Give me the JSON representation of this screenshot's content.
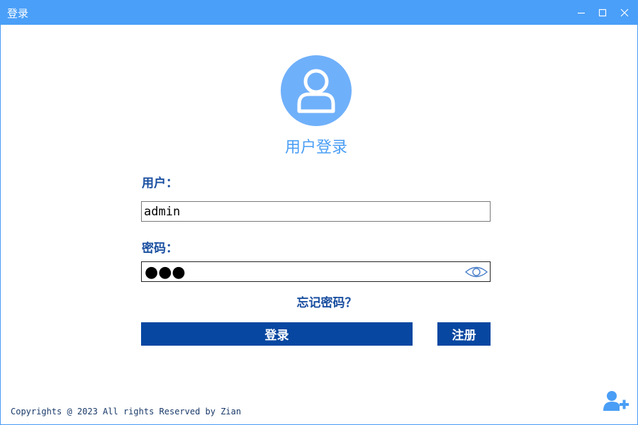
{
  "window": {
    "title": "登录",
    "controls": {
      "minimize": "minimize-icon",
      "maximize": "maximize-icon",
      "close": "close-icon"
    }
  },
  "login": {
    "avatar_icon": "user-avatar-icon",
    "heading": "用户登录",
    "username_label": "用户：",
    "username_value": "admin",
    "password_label": "密码：",
    "password_mask": "●●●",
    "password_toggle_icon": "eye-icon",
    "forgot_link": "忘记密码？",
    "login_button": "登录",
    "register_button": "注册"
  },
  "footer": {
    "copyright": "Copyrights @ 2023 All rights Reserved by Zian",
    "add_user_icon": "add-user-icon"
  },
  "colors": {
    "titlebar": "#4a9ff8",
    "avatar_bg": "#6fb0fa",
    "heading": "#4a9ef5",
    "label": "#1a4fa0",
    "button": "#0747a1",
    "border": "#4a9bf7"
  }
}
